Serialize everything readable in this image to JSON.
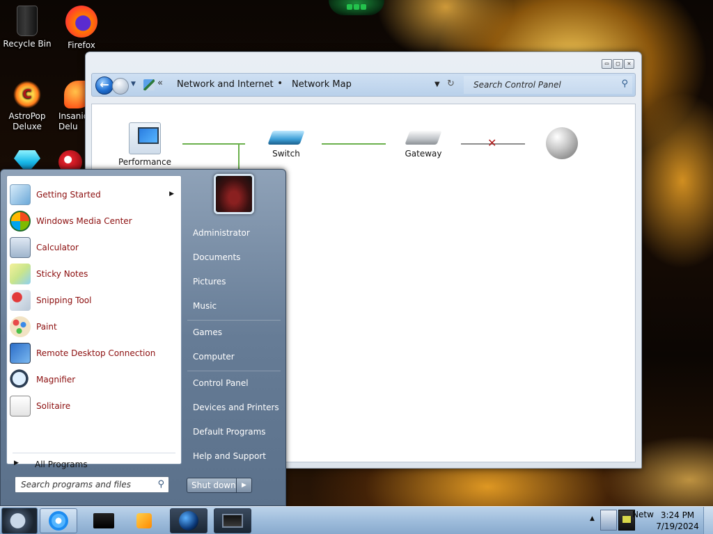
{
  "desktop": {
    "icons": [
      {
        "label": "Recycle Bin",
        "icon": "recycle-bin-icon"
      },
      {
        "label": "Firefox",
        "icon": "firefox-icon"
      },
      {
        "label": "AstroPop Deluxe",
        "icon": "astropop-icon"
      },
      {
        "label": "Insaniq Delu",
        "icon": "insaniquarium-icon"
      },
      {
        "label": "",
        "icon": "gem-game-icon"
      },
      {
        "label": "",
        "icon": "red-game-icon"
      }
    ]
  },
  "explorer": {
    "controls": {
      "minimize": "▭",
      "maximize": "▢",
      "close": "✕"
    },
    "breadcrumb": {
      "more": "«",
      "items": [
        "Network and Internet",
        "Network Map"
      ],
      "separator": "•"
    },
    "search": {
      "placeholder": "Search Control Panel"
    },
    "network_map": {
      "nodes": [
        {
          "label": "Performance",
          "icon": "computer-icon"
        },
        {
          "label": "Switch",
          "icon": "switch-icon"
        },
        {
          "label": "Gateway",
          "icon": "gateway-icon"
        },
        {
          "label": "",
          "icon": "internet-globe-icon"
        }
      ],
      "broken_link_marker": "✕"
    }
  },
  "start_menu": {
    "programs": [
      {
        "label": "Getting Started",
        "icon": "getting-started-icon",
        "has_submenu": true
      },
      {
        "label": "Windows Media Center",
        "icon": "windows-media-center-icon"
      },
      {
        "label": "Calculator",
        "icon": "calculator-icon"
      },
      {
        "label": "Sticky Notes",
        "icon": "sticky-notes-icon"
      },
      {
        "label": "Snipping Tool",
        "icon": "snipping-tool-icon"
      },
      {
        "label": "Paint",
        "icon": "paint-icon"
      },
      {
        "label": "Remote Desktop Connection",
        "icon": "remote-desktop-icon"
      },
      {
        "label": "Magnifier",
        "icon": "magnifier-icon"
      },
      {
        "label": "Solitaire",
        "icon": "solitaire-icon"
      }
    ],
    "all_programs": "All Programs",
    "search_placeholder": "Search programs and files",
    "right_items": [
      "Administrator",
      "Documents",
      "Pictures",
      "Music",
      "Games",
      "Computer",
      "Control Panel",
      "Devices and Printers",
      "Default Programs",
      "Help and Support"
    ],
    "shutdown_label": "Shut down"
  },
  "taskbar": {
    "pinned": [
      "internet-explorer-icon",
      "tv-app-icon",
      "media-player-icon",
      "globe-app-icon",
      "monitor-app-icon"
    ],
    "tray_label": "Netw",
    "clock": {
      "time": "3:24 PM",
      "date": "7/19/2024"
    }
  },
  "colors": {
    "program_label": "#8b0d0d",
    "taskbar": "#9fbddc",
    "network_link": "#6ab04c"
  }
}
